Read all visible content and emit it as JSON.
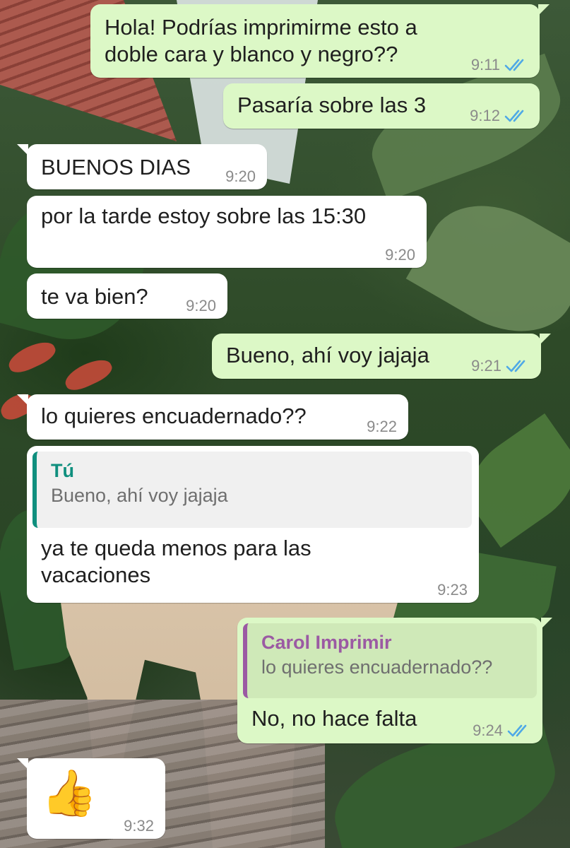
{
  "colors": {
    "outgoing_bubble": "#dcf8c6",
    "incoming_bubble": "#ffffff",
    "read_ticks": "#4fa9e6",
    "quote_author_self": "#0f8f7e",
    "quote_author_contact": "#9b5aa3"
  },
  "messages": [
    {
      "direction": "out",
      "text": "Hola! Podrías imprimirme esto a\ndoble cara y blanco y negro??",
      "time": "9:11",
      "status": "read-double-check-icon"
    },
    {
      "direction": "out",
      "text": "Pasaría sobre las 3",
      "time": "9:12",
      "status": "read-double-check-icon"
    },
    {
      "direction": "in",
      "text": "BUENOS DIAS",
      "time": "9:20"
    },
    {
      "direction": "in",
      "text": "por la tarde estoy sobre las 15:30",
      "time": "9:20"
    },
    {
      "direction": "in",
      "text": "te va bien?",
      "time": "9:20"
    },
    {
      "direction": "out",
      "text": "Bueno, ahí voy jajaja",
      "time": "9:21",
      "status": "read-double-check-icon"
    },
    {
      "direction": "in",
      "text": "lo quieres encuadernado??",
      "time": "9:22"
    },
    {
      "direction": "in",
      "quote": {
        "author": "Tú",
        "text": "Bueno, ahí voy jajaja"
      },
      "text": "ya te queda menos para las\nvacaciones",
      "time": "9:23"
    },
    {
      "direction": "out",
      "quote": {
        "author": "Carol Imprimir",
        "text": "lo quieres encuadernado??"
      },
      "text": "No, no hace falta",
      "time": "9:24",
      "status": "read-double-check-icon"
    },
    {
      "direction": "in",
      "text": "👍",
      "emoji": "thumbs-up-icon",
      "time": "9:32"
    }
  ]
}
